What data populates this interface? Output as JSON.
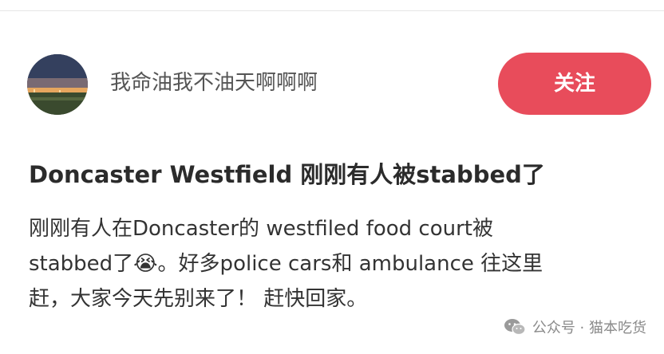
{
  "author": {
    "name": "我命油我不油天啊啊啊",
    "follow_label": "关注",
    "avatar_icon": "sunset-field-avatar"
  },
  "post": {
    "title": "Doncaster Westfield 刚刚有人被stabbed了",
    "body_lines": [
      "刚刚有人在Doncaster的 westfiled food court被",
      "stabbed了😭。好多police cars和 ambulance 往这里",
      "赶，大家今天先别来了！ 赶快回家。"
    ]
  },
  "watermark": {
    "text": "公众号 · 猫本吃货",
    "icon": "wechat-icon"
  },
  "colors": {
    "accent": "#e84c5b",
    "text": "#333333",
    "muted": "#8a8a8a"
  }
}
